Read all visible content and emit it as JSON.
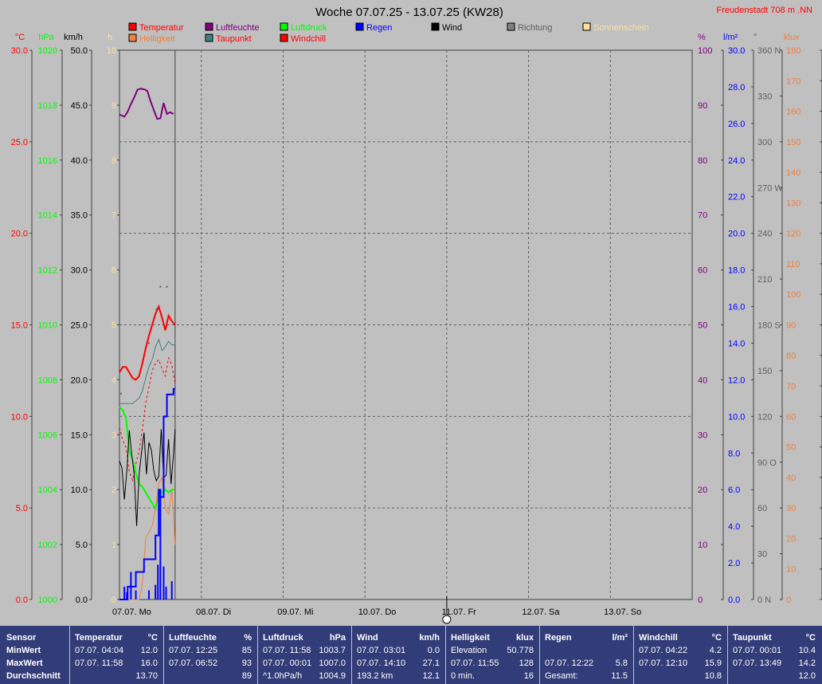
{
  "chart_data": {
    "type": "line",
    "title": "Woche 07.07.25 - 13.07.25 (KW28)",
    "location": "Freudenstadt 708 m  .NN",
    "day_labels": [
      "07.07. Mo",
      "08.07. Di",
      "09.07. Mi",
      "10.07. Do",
      "11.07. Fr",
      "12.07. Sa",
      "13.07. So"
    ],
    "x_unit": "day",
    "x_range": [
      0,
      7
    ],
    "cursor_day": 4,
    "grid": true,
    "legend": [
      {
        "label": "Temperatur",
        "color": "#ff0000",
        "text_color": "#ff0000"
      },
      {
        "label": "Luftfeuchte",
        "color": "#800080",
        "text_color": "#800080"
      },
      {
        "label": "Luftdruck",
        "color": "#00ff00",
        "text_color": "#00ff00"
      },
      {
        "label": "Regen",
        "color": "#0000ff",
        "text_color": "#0000ff"
      },
      {
        "label": "Wind",
        "color": "#000000",
        "text_color": "#000000"
      },
      {
        "label": "Richtung",
        "color": "#808080",
        "text_color": "#606060"
      },
      {
        "label": "Sonnenschein",
        "color": "#ffe0a0",
        "text_color": "#ffe0a0"
      },
      {
        "label": "Helligkeit",
        "color": "#f08040",
        "text_color": "#f08040"
      },
      {
        "label": "Taupunkt",
        "color": "#408080",
        "text_color": "#ff0000"
      },
      {
        "label": "Windchill",
        "color": "#ff0000",
        "text_color": "#ff0000"
      }
    ],
    "axes": [
      {
        "unit": "°C",
        "color": "#ff0000",
        "range": [
          0,
          30
        ],
        "ticks": [
          "0.0",
          "5.0",
          "10.0",
          "15.0",
          "20.0",
          "25.0",
          "30.0"
        ]
      },
      {
        "unit": "hPa",
        "color": "#00ff00",
        "range": [
          1000,
          1020
        ],
        "ticks": [
          "1000",
          "1002",
          "1004",
          "1006",
          "1008",
          "1010",
          "1012",
          "1014",
          "1016",
          "1018",
          "1020"
        ]
      },
      {
        "unit": "km/h",
        "color": "#000000",
        "range": [
          0,
          50
        ],
        "ticks": [
          "0.0",
          "5.0",
          "10.0",
          "15.0",
          "20.0",
          "25.0",
          "30.0",
          "35.0",
          "40.0",
          "45.0",
          "50.0"
        ]
      },
      {
        "unit": "h",
        "color": "#ffe0a0",
        "range": [
          0,
          10
        ],
        "ticks": [
          "0",
          "1",
          "2",
          "3",
          "4",
          "5",
          "6",
          "7",
          "8",
          "9",
          "10"
        ]
      },
      {
        "unit": "%",
        "color": "#800080",
        "range": [
          0,
          100
        ],
        "ticks": [
          "0",
          "10",
          "20",
          "30",
          "40",
          "50",
          "60",
          "70",
          "80",
          "90",
          "100"
        ]
      },
      {
        "unit": "l/m²",
        "color": "#0000ff",
        "range": [
          0,
          30
        ],
        "ticks": [
          "0.0",
          "2.0",
          "4.0",
          "6.0",
          "8.0",
          "10.0",
          "12.0",
          "14.0",
          "16.0",
          "18.0",
          "20.0",
          "22.0",
          "24.0",
          "26.0",
          "28.0",
          "30.0"
        ]
      },
      {
        "unit": "°",
        "color": "#606060",
        "range": [
          0,
          360
        ],
        "ticks": [
          "0 N",
          "30",
          "60",
          "90 O",
          "120",
          "150",
          "180 S",
          "210",
          "240",
          "270 W",
          "300",
          "330",
          "360 N"
        ]
      },
      {
        "unit": "klux",
        "color": "#f08040",
        "range": [
          0,
          180
        ],
        "ticks": [
          "0",
          "10",
          "20",
          "30",
          "40",
          "50",
          "60",
          "70",
          "80",
          "90",
          "100",
          "110",
          "120",
          "130",
          "140",
          "150",
          "160",
          "170",
          "180"
        ]
      }
    ],
    "series": [
      {
        "name": "Luftfeuchte",
        "axis": 4,
        "color": "#800080",
        "width": 2,
        "x": [
          0.0,
          0.06,
          0.1,
          0.14,
          0.18,
          0.22,
          0.26,
          0.3,
          0.34,
          0.38,
          0.42,
          0.46,
          0.5,
          0.54,
          0.58,
          0.62,
          0.66
        ],
        "values": [
          88.3,
          87.9,
          88.8,
          90.2,
          91.4,
          92.8,
          93.0,
          92.9,
          92.6,
          90.7,
          89.1,
          87.5,
          87.6,
          90.4,
          88.4,
          88.7,
          88.4
        ]
      },
      {
        "name": "Temperatur",
        "axis": 0,
        "color": "#ff0000",
        "width": 2,
        "x": [
          0.0,
          0.04,
          0.08,
          0.12,
          0.16,
          0.2,
          0.24,
          0.28,
          0.32,
          0.36,
          0.4,
          0.44,
          0.48,
          0.52,
          0.56,
          0.6,
          0.64,
          0.68
        ],
        "values": [
          12.4,
          12.7,
          12.7,
          12.4,
          12.1,
          12.0,
          12.2,
          12.9,
          13.7,
          14.4,
          15.0,
          15.6,
          16.0,
          15.4,
          14.7,
          15.5,
          15.2,
          15.0
        ]
      },
      {
        "name": "Taupunkt",
        "axis": 0,
        "color": "#408080",
        "width": 1,
        "x": [
          0.0,
          0.08,
          0.16,
          0.24,
          0.28,
          0.32,
          0.36,
          0.4,
          0.44,
          0.48,
          0.52,
          0.56,
          0.6,
          0.64,
          0.68
        ],
        "values": [
          10.7,
          10.7,
          10.7,
          11.0,
          11.4,
          12.1,
          12.7,
          13.1,
          13.8,
          14.2,
          13.6,
          13.8,
          14.1,
          13.9,
          13.9
        ]
      },
      {
        "name": "Windchill",
        "axis": 0,
        "color": "#ff0000",
        "width": 1,
        "dash": "3,3",
        "x": [
          0.0,
          0.04,
          0.08,
          0.12,
          0.16,
          0.2,
          0.24,
          0.28,
          0.32,
          0.36,
          0.4,
          0.44,
          0.48,
          0.52,
          0.56,
          0.6,
          0.64,
          0.68
        ],
        "values": [
          9.4,
          8.7,
          8.3,
          7.0,
          6.5,
          7.4,
          8.1,
          9.3,
          10.7,
          11.6,
          12.5,
          12.9,
          13.1,
          12.6,
          12.2,
          13.2,
          12.8,
          11.8
        ]
      },
      {
        "name": "Luftdruck",
        "axis": 1,
        "color": "#00ff00",
        "width": 2,
        "x": [
          0.0,
          0.04,
          0.08,
          0.12,
          0.16,
          0.2,
          0.24,
          0.28,
          0.32,
          0.36,
          0.4,
          0.44,
          0.48,
          0.52,
          0.56,
          0.6,
          0.64,
          0.68
        ],
        "values": [
          1007.0,
          1006.9,
          1006.6,
          1005.4,
          1005.1,
          1004.6,
          1004.2,
          1004.1,
          1003.9,
          1003.7,
          1003.5,
          1003.3,
          1003.9,
          1003.9,
          1004.0,
          1003.9,
          1004.0,
          1004.0
        ]
      },
      {
        "name": "Wind",
        "axis": 2,
        "color": "#000000",
        "width": 1,
        "x": [
          0.0,
          0.03,
          0.06,
          0.09,
          0.12,
          0.15,
          0.18,
          0.21,
          0.24,
          0.27,
          0.3,
          0.33,
          0.36,
          0.39,
          0.42,
          0.45,
          0.48,
          0.51,
          0.54,
          0.57,
          0.6,
          0.63,
          0.66,
          0.68
        ],
        "values": [
          12.6,
          12.0,
          9.1,
          11.7,
          15.4,
          13.2,
          11.4,
          6.7,
          11.4,
          13.4,
          15.2,
          11.4,
          14.3,
          13.6,
          11.7,
          10.8,
          11.2,
          15.5,
          11.1,
          11.3,
          14.6,
          10.5,
          13.2,
          15.5
        ]
      },
      {
        "name": "Helligkeit",
        "axis": 7,
        "color": "#f08040",
        "width": 1,
        "x": [
          0.0,
          0.08,
          0.16,
          0.24,
          0.28,
          0.32,
          0.36,
          0.4,
          0.44,
          0.48,
          0.52,
          0.56,
          0.6,
          0.64,
          0.68
        ],
        "values": [
          0,
          0,
          0,
          0,
          5,
          20,
          22,
          24,
          30,
          38,
          40,
          30,
          28,
          36,
          18
        ]
      },
      {
        "name": "Regen",
        "axis": 5,
        "color": "#0000ff",
        "width": 2,
        "step": true,
        "x": [
          0.0,
          0.05,
          0.1,
          0.14,
          0.2,
          0.24,
          0.3,
          0.36,
          0.4,
          0.44,
          0.48,
          0.5,
          0.54,
          0.58,
          0.62,
          0.66,
          0.68
        ],
        "values": [
          0,
          0,
          0.7,
          0.7,
          1.5,
          1.5,
          2.2,
          2.2,
          2.2,
          3.5,
          6.0,
          5.6,
          10.0,
          11.2,
          11.2,
          11.5,
          11.5
        ]
      }
    ],
    "rain_bars": {
      "axis": 5,
      "color": "#0000ff",
      "x": [
        0.06,
        0.09,
        0.14,
        0.2,
        0.36,
        0.44,
        0.47,
        0.5,
        0.54,
        0.57,
        0.64
      ],
      "values": [
        0.7,
        0.4,
        1.5,
        0.5,
        0.5,
        0.8,
        1.9,
        5.8,
        1.8,
        0.7,
        1.0
      ]
    },
    "direction_points": {
      "axis": 6,
      "color": "#606060",
      "x": [
        0.02,
        0.36,
        0.45,
        0.5,
        0.58
      ],
      "values": [
        135,
        168,
        190,
        205,
        205
      ]
    }
  },
  "stats": {
    "sensor": {
      "header": "Sensor",
      "rows": [
        "MinWert",
        "MaxWert",
        "Durchschnitt"
      ]
    },
    "columns": [
      {
        "name": "Temperatur",
        "unit": "°C",
        "rows": [
          [
            "07.07.  04:04",
            "12.0"
          ],
          [
            "07.07.  11:58",
            "16.0"
          ],
          [
            "",
            "13.70"
          ]
        ]
      },
      {
        "name": "Luftfeuchte",
        "unit": "%",
        "rows": [
          [
            "07.07.  12:25",
            "85"
          ],
          [
            "07.07.  06:52",
            "93"
          ],
          [
            "",
            "89"
          ]
        ]
      },
      {
        "name": "Luftdruck",
        "unit": "hPa",
        "rows": [
          [
            "07.07.  11:58",
            "1003.7"
          ],
          [
            "07.07.  00:01",
            "1007.0"
          ],
          [
            "^1.0hPa/h",
            "1004.9"
          ]
        ]
      },
      {
        "name": "Wind",
        "unit": "km/h",
        "rows": [
          [
            "07.07.  03:01",
            "0.0"
          ],
          [
            "07.07.  14:10",
            "27.1"
          ],
          [
            "193.2 km",
            "12.1"
          ]
        ]
      },
      {
        "name": "Helligkeit",
        "unit": "klux",
        "rows": [
          [
            "Elevation",
            "50.778"
          ],
          [
            "07.07.  11:55",
            "128"
          ],
          [
            "0 min.",
            "16"
          ]
        ]
      },
      {
        "name": "Regen",
        "unit": "l/m²",
        "rows": [
          [
            "",
            ""
          ],
          [
            "07.07.  12:22",
            "5.8"
          ],
          [
            "Gesamt:",
            "11.5"
          ]
        ]
      },
      {
        "name": "Windchill",
        "unit": "°C",
        "rows": [
          [
            "07.07.  04:22",
            "4.2"
          ],
          [
            "07.07.  12:10",
            "15.9"
          ],
          [
            "",
            "10.8"
          ]
        ]
      },
      {
        "name": "Taupunkt",
        "unit": "°C",
        "rows": [
          [
            "07.07.  00:01",
            "10.4"
          ],
          [
            "07.07.  13:49",
            "14.2"
          ],
          [
            "",
            "12.0"
          ]
        ]
      }
    ]
  }
}
